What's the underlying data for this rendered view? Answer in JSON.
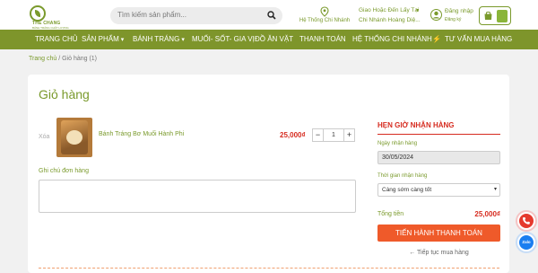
{
  "colors": {
    "brand_green": "#7a9a2c",
    "nav_bg": "#7e952b",
    "price_red": "#d62b1f",
    "checkout_orange": "#ef5a2a"
  },
  "header": {
    "logo_name": "THẾ CHANG",
    "logo_tagline": "BÁNH TRÁNG CHẤT LƯỢNG",
    "search_placeholder": "Tìm kiếm sản phẩm...",
    "branch_label": "Hệ Thống Chi Nhánh",
    "delivery_mode": "Giao Hoặc Đến Lấy Tại",
    "delivery_branch": "Chi Nhánh Hoàng Diệ...",
    "login_label": "Đăng nhập",
    "register_label": "Đăng ký",
    "icons": {
      "search": "search-icon",
      "branch": "map-pin-icon",
      "user": "user-icon",
      "cart": "shopping-bag-icon"
    }
  },
  "nav": {
    "items": [
      {
        "label": "TRANG CHỦ",
        "has_dropdown": false
      },
      {
        "label": "SẢN PHẨM",
        "has_dropdown": true
      },
      {
        "label": "BÁNH TRÁNG",
        "has_dropdown": true
      },
      {
        "label": "MUỐI- SỐT- GIA VỊ",
        "has_dropdown": false
      },
      {
        "label": "ĐỒ ĂN VẶT",
        "has_dropdown": false
      },
      {
        "label": "THANH TOÁN",
        "has_dropdown": false
      },
      {
        "label": "HỆ THỐNG CHI NHÁNH",
        "has_dropdown": false
      },
      {
        "label": "TƯ VẤN MUA HÀNG",
        "has_dropdown": false,
        "icon": "lightning-icon"
      }
    ]
  },
  "breadcrumb": {
    "home": "Trang chủ",
    "current": " / Giỏ hàng (1)"
  },
  "cart": {
    "title": "Giỏ hàng",
    "items": [
      {
        "remove_label": "Xóa",
        "name": "Bánh Tráng Bơ Muối Hành Phi",
        "price": "25,000₫",
        "quantity": "1"
      }
    ],
    "qty_minus": "−",
    "qty_plus": "+",
    "note_label": "Ghi chú đơn hàng"
  },
  "pickup": {
    "title": "HẸN GIỜ NHẬN HÀNG",
    "date_label": "Ngày nhận hàng",
    "date_value": "30/05/2024",
    "time_label": "Thời gian nhận hàng",
    "time_value": "Càng sớm càng tốt",
    "total_label": "Tổng tiền",
    "total_value": "25,000₫",
    "checkout_label": "TIẾN HÀNH THANH TOÁN",
    "continue_label": "← Tiếp tục mua hàng"
  },
  "floating": {
    "zalo_label": "Zalo"
  }
}
